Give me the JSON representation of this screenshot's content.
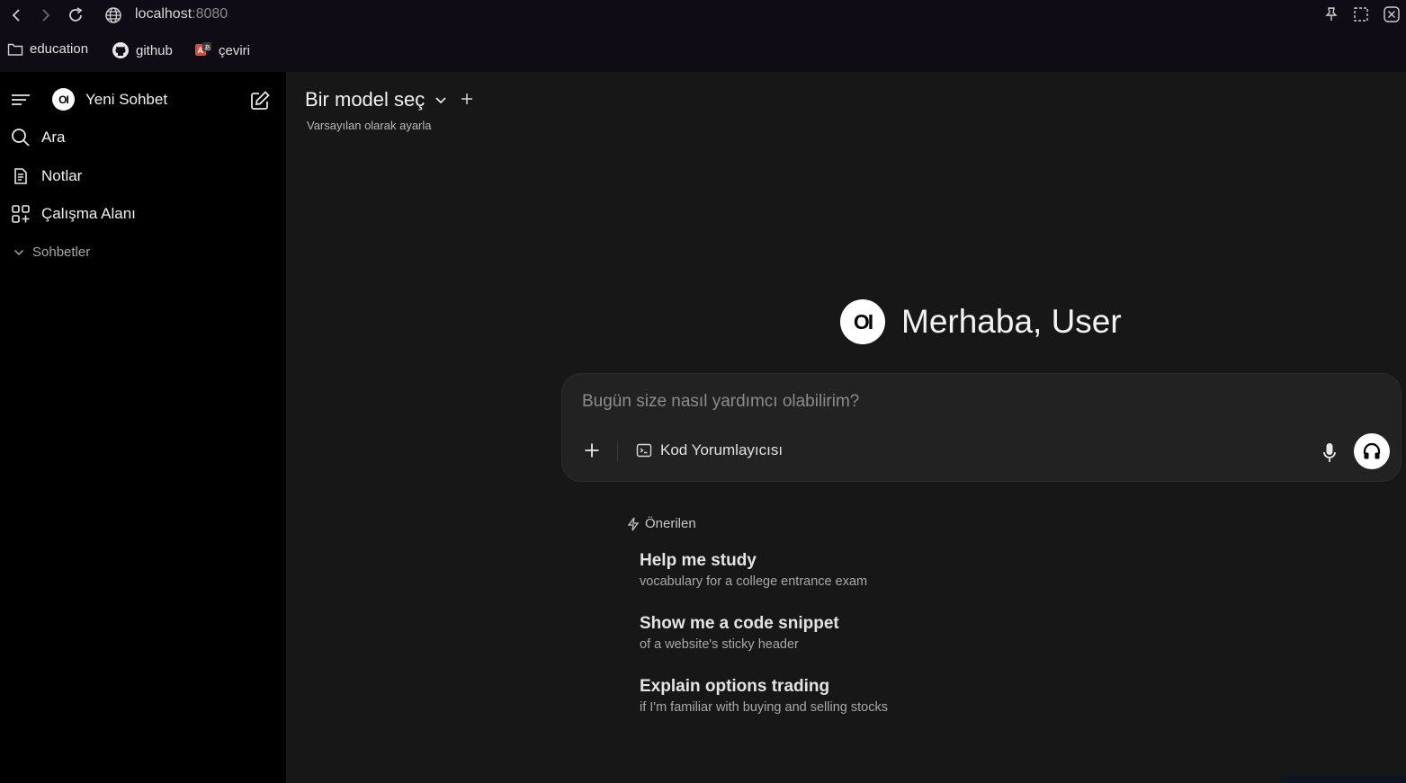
{
  "browser": {
    "url_host": "localhost",
    "url_port": ":8080"
  },
  "bookmarks": [
    {
      "label": "education",
      "icon": "folder-icon"
    },
    {
      "label": "github",
      "icon": "github-icon"
    },
    {
      "label": "çeviri",
      "icon": "translate-icon"
    }
  ],
  "sidebar": {
    "new_chat_label": "Yeni Sohbet",
    "items": [
      {
        "label": "Ara",
        "icon": "search-icon"
      },
      {
        "label": "Notlar",
        "icon": "notes-icon"
      },
      {
        "label": "Çalışma Alanı",
        "icon": "workspace-icon"
      }
    ],
    "section_label": "Sohbetler",
    "logo_text": "OI"
  },
  "header": {
    "model_select_label": "Bir model seç",
    "set_default_label": "Varsayılan olarak ayarla"
  },
  "greeting": {
    "logo_text": "OI",
    "text": "Merhaba, User"
  },
  "composer": {
    "placeholder": "Bugün size nasıl yardımcı olabilirim?",
    "tool_label": "Kod Yorumlayıcısı"
  },
  "suggestions": {
    "heading": "Önerilen",
    "items": [
      {
        "title": "Help me study",
        "subtitle": "vocabulary for a college entrance exam"
      },
      {
        "title": "Show me a code snippet",
        "subtitle": "of a website's sticky header"
      },
      {
        "title": "Explain options trading",
        "subtitle": "if I'm familiar with buying and selling stocks"
      }
    ]
  }
}
